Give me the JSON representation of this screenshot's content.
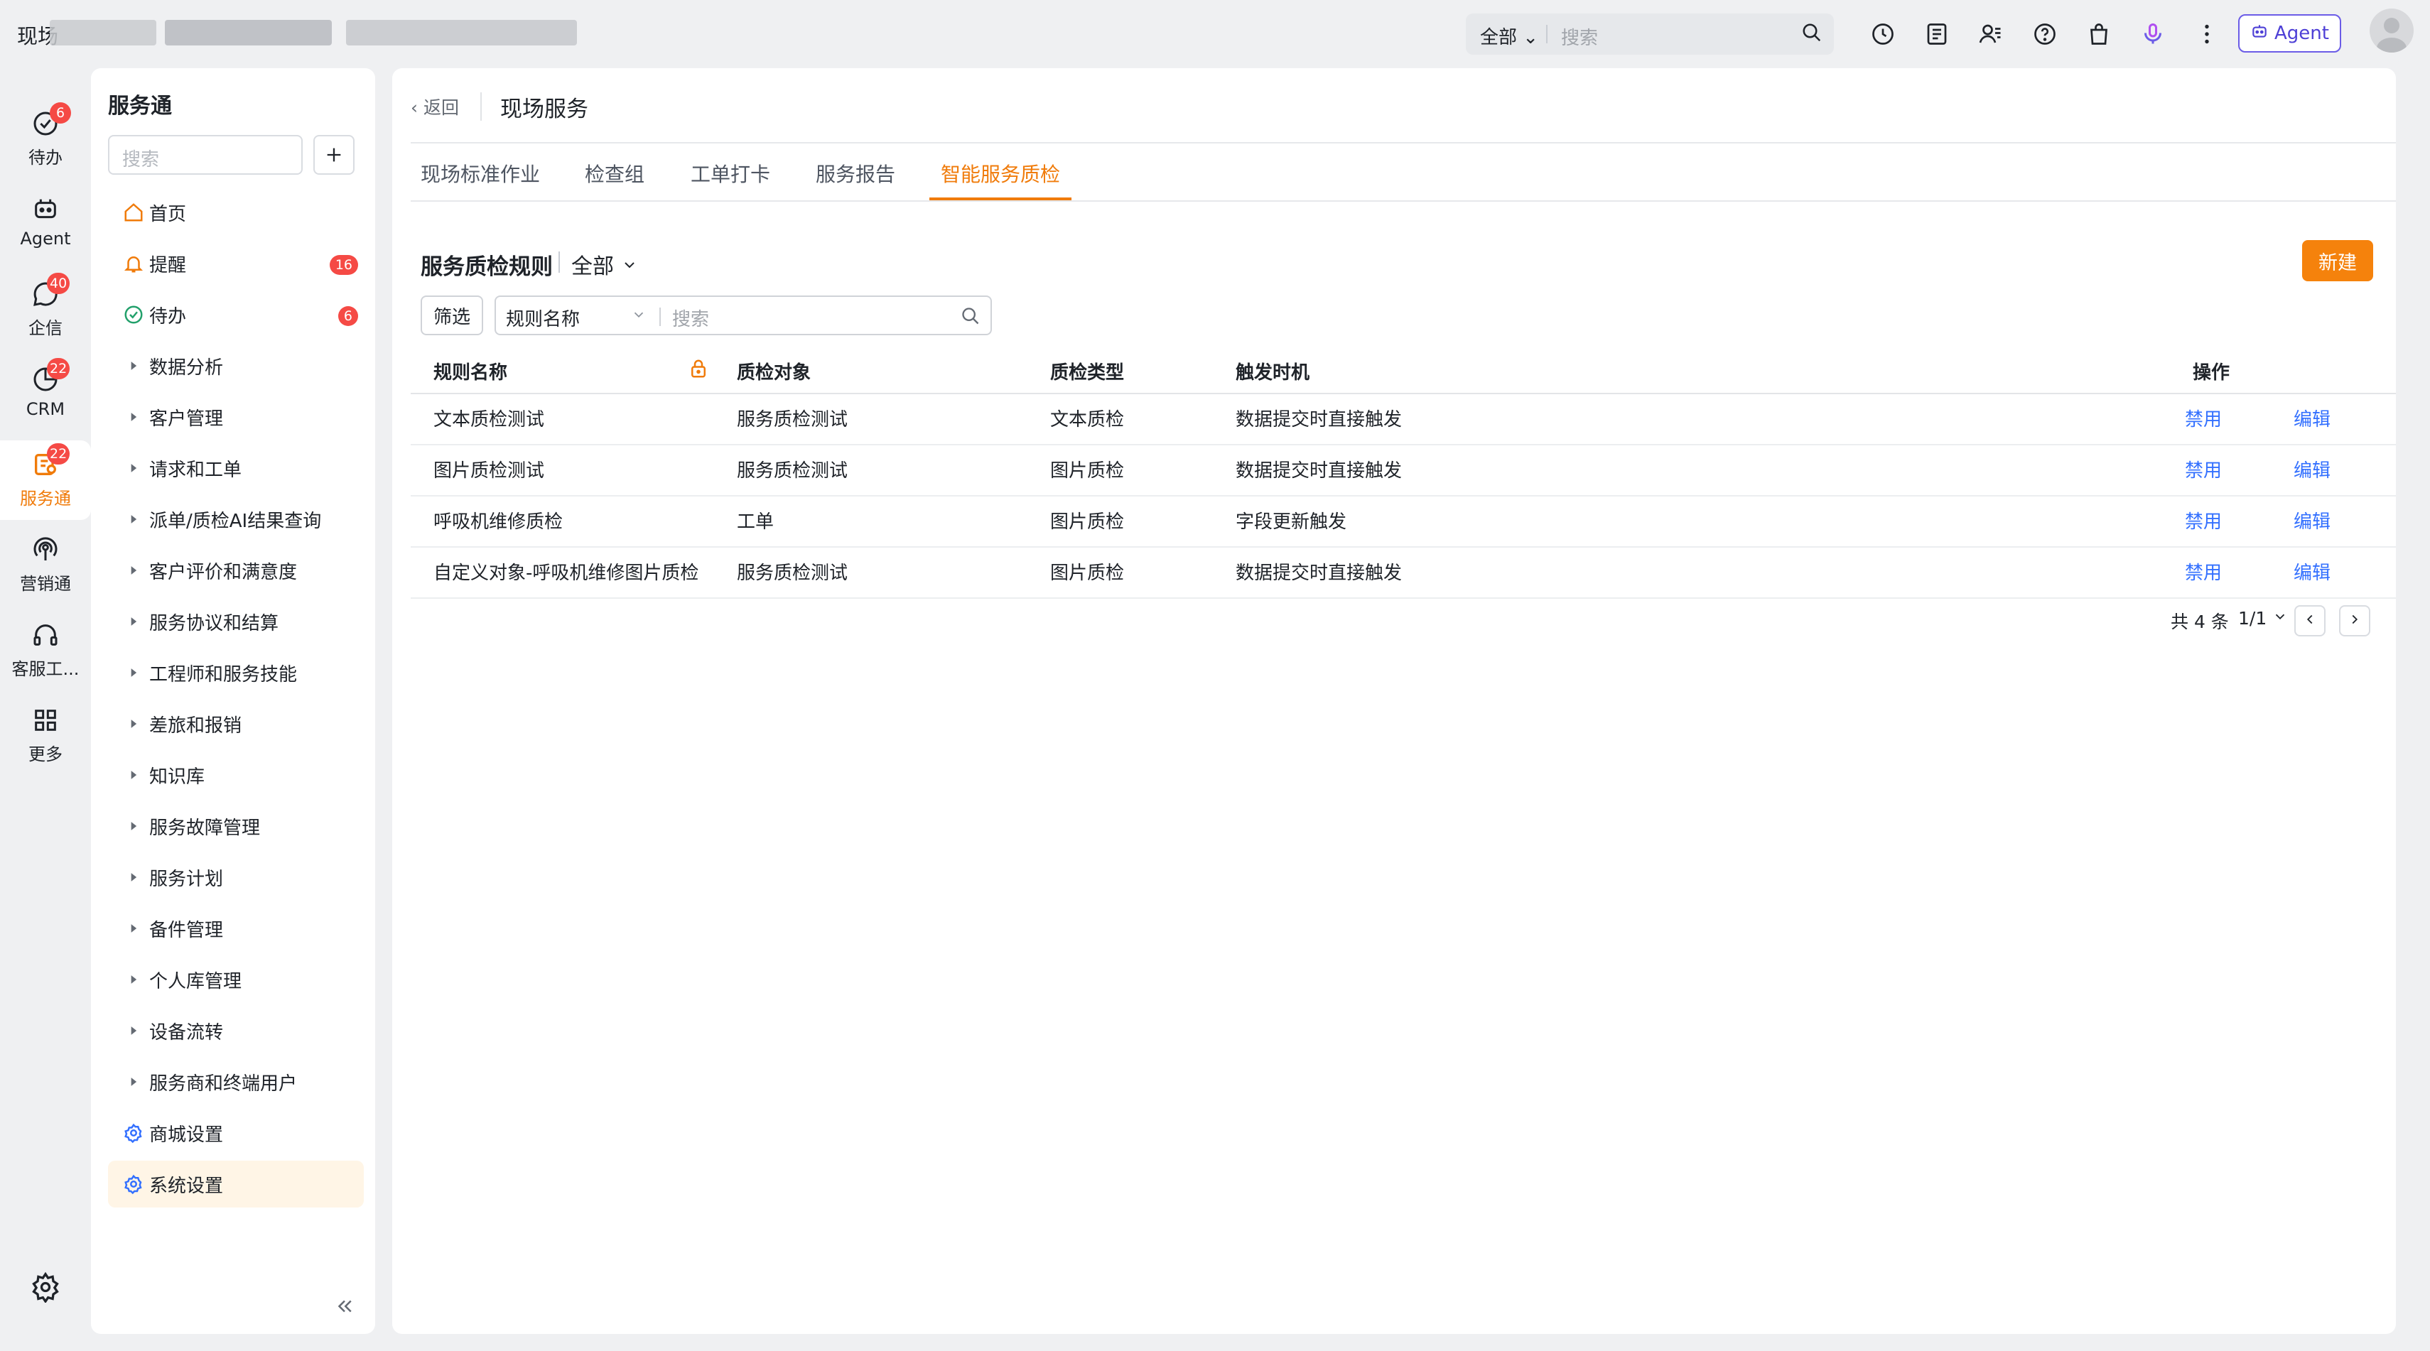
{
  "topbar": {
    "org_name": "现场",
    "search_scope": "全部",
    "search_placeholder": "搜索",
    "agent_label": "Agent",
    "icons": [
      "clock-icon",
      "task-list-icon",
      "contacts-icon",
      "help-icon",
      "bag-icon",
      "mic-icon",
      "more-vertical-icon"
    ]
  },
  "rail": [
    {
      "label": "待办",
      "icon": "check-circle-icon",
      "badge": "6"
    },
    {
      "label": "Agent",
      "icon": "robot-icon",
      "badge": ""
    },
    {
      "label": "企信",
      "icon": "chat-icon",
      "badge": "40"
    },
    {
      "label": "CRM",
      "icon": "crm-icon",
      "badge": "22"
    },
    {
      "label": "服务通",
      "icon": "service-icon",
      "badge": "22",
      "active": true
    },
    {
      "label": "营销通",
      "icon": "broadcast-icon",
      "badge": ""
    },
    {
      "label": "客服工...",
      "icon": "headset-icon",
      "badge": ""
    },
    {
      "label": "更多",
      "icon": "grid-icon",
      "badge": ""
    }
  ],
  "sidebar": {
    "title": "服务通",
    "search_placeholder": "搜索",
    "items": [
      {
        "label": "首页",
        "icon": "home-icon",
        "count": ""
      },
      {
        "label": "提醒",
        "icon": "bell-icon",
        "count": "16"
      },
      {
        "label": "待办",
        "icon": "check-circle-icon",
        "count": "6"
      },
      {
        "label": "数据分析",
        "icon": "caret-right-icon",
        "count": ""
      },
      {
        "label": "客户管理",
        "icon": "caret-right-icon",
        "count": ""
      },
      {
        "label": "请求和工单",
        "icon": "caret-right-icon",
        "count": ""
      },
      {
        "label": "派单/质检AI结果查询",
        "icon": "caret-right-icon",
        "count": ""
      },
      {
        "label": "客户评价和满意度",
        "icon": "caret-right-icon",
        "count": ""
      },
      {
        "label": "服务协议和结算",
        "icon": "caret-right-icon",
        "count": ""
      },
      {
        "label": "工程师和服务技能",
        "icon": "caret-right-icon",
        "count": ""
      },
      {
        "label": "差旅和报销",
        "icon": "caret-right-icon",
        "count": ""
      },
      {
        "label": "知识库",
        "icon": "caret-right-icon",
        "count": ""
      },
      {
        "label": "服务故障管理",
        "icon": "caret-right-icon",
        "count": ""
      },
      {
        "label": "服务计划",
        "icon": "caret-right-icon",
        "count": ""
      },
      {
        "label": "备件管理",
        "icon": "caret-right-icon",
        "count": ""
      },
      {
        "label": "个人库管理",
        "icon": "caret-right-icon",
        "count": ""
      },
      {
        "label": "设备流转",
        "icon": "caret-right-icon",
        "count": ""
      },
      {
        "label": "服务商和终端用户",
        "icon": "caret-right-icon",
        "count": ""
      },
      {
        "label": "商城设置",
        "icon": "gear-blue-icon",
        "count": ""
      },
      {
        "label": "系统设置",
        "icon": "gear-blue-icon",
        "count": "",
        "active": true
      }
    ]
  },
  "main": {
    "back_label": "返回",
    "page_title": "现场服务",
    "tabs": [
      "现场标准作业",
      "检查组",
      "工单打卡",
      "服务报告",
      "智能服务质检"
    ],
    "active_tab": "智能服务质检",
    "section_title": "服务质检规则",
    "section_scope": "全部",
    "new_button": "新建",
    "filter_button": "筛选",
    "filter_field": "规则名称",
    "filter_placeholder": "搜索",
    "columns": [
      "规则名称",
      "质检对象",
      "质检类型",
      "触发时机",
      "操作"
    ],
    "rows": [
      {
        "name": "文本质检测试",
        "object": "服务质检测试",
        "type": "文本质检",
        "trigger": "数据提交时直接触发",
        "disable": "禁用",
        "edit": "编辑"
      },
      {
        "name": "图片质检测试",
        "object": "服务质检测试",
        "type": "图片质检",
        "trigger": "数据提交时直接触发",
        "disable": "禁用",
        "edit": "编辑"
      },
      {
        "name": "呼吸机维修质检",
        "object": "工单",
        "type": "图片质检",
        "trigger": "字段更新触发",
        "disable": "禁用",
        "edit": "编辑"
      },
      {
        "name": "自定义对象-呼吸机维修图片质检",
        "object": "服务质检测试",
        "type": "图片质检",
        "trigger": "数据提交时直接触发",
        "disable": "禁用",
        "edit": "编辑"
      }
    ],
    "pager_total": "共 4 条",
    "pager_page": "1/1"
  },
  "colors": {
    "accent": "#f5820c",
    "link": "#3370ff",
    "badge": "#f54a45",
    "agent": "#6b5ce7"
  }
}
